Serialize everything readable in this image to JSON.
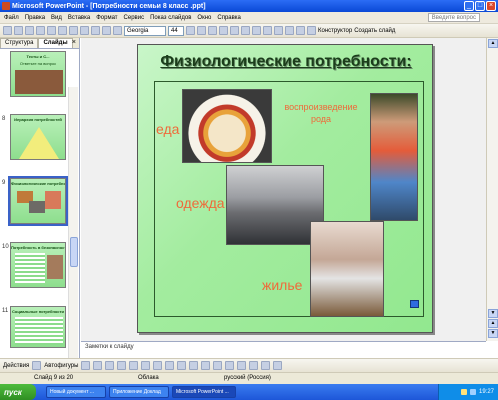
{
  "window": {
    "title": "Microsoft PowerPoint - [Потребности семьи 8 класс .ppt]"
  },
  "menu": {
    "items": [
      "Файл",
      "Правка",
      "Вид",
      "Вставка",
      "Формат",
      "Сервис",
      "Показ слайдов",
      "Окно",
      "Справка"
    ],
    "help_placeholder": "Введите вопрос"
  },
  "toolbar": {
    "font": "Georgia",
    "size": "44",
    "designer": "Конструктор",
    "new_slide": "Создать слайд"
  },
  "left_pane": {
    "tab_structure": "Структура",
    "tab_slides": "Слайды",
    "close": "×",
    "slides": [
      {
        "num": "",
        "title": "Тесты и С...",
        "subtitle": "Ответьте на вопрос"
      },
      {
        "num": "8",
        "title": "Иерархия потребностей"
      },
      {
        "num": "9",
        "title": "Физиологические потребности"
      },
      {
        "num": "10",
        "title": "Потребность в безопасности"
      },
      {
        "num": "11",
        "title": "Социальные потребности"
      }
    ]
  },
  "slide": {
    "title": "Физиологические потребности:",
    "labels": {
      "food": "еда",
      "reproduction": "воспроизведение рода",
      "clothes": "одежда",
      "housing": "жилье"
    }
  },
  "notes": {
    "placeholder": "Заметки к слайду"
  },
  "drawbar": {
    "actions": "Действия",
    "autoshapes": "Автофигуры"
  },
  "status": {
    "slide": "Слайд 9 из 20",
    "design": "Облака",
    "language": "русский (Россия)"
  },
  "taskbar": {
    "start": "пуск",
    "tasks": [
      "Новый документ ...",
      "Приложение Доклад",
      "Microsoft PowerPoint ..."
    ],
    "clock": "19:27"
  }
}
